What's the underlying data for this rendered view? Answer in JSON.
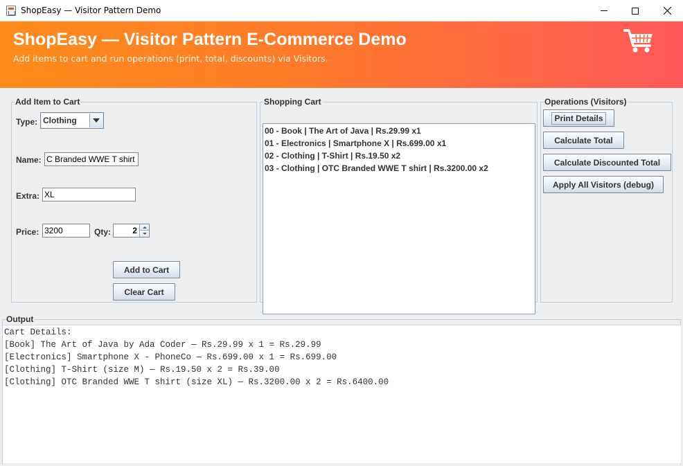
{
  "window": {
    "title": "ShopEasy — Visitor Pattern Demo"
  },
  "header": {
    "title": "ShopEasy — Visitor Pattern E-Commerce Demo",
    "subtitle": "Add items to cart and run operations (print, total, discounts) via Visitors.",
    "icon": "shopping-cart-icon"
  },
  "add_item": {
    "group_label": "Add Item to Cart",
    "type_label": "Type:",
    "type_value": "Clothing",
    "name_label": "Name:",
    "name_value": "C Branded WWE T shirt",
    "extra_label": "Extra:",
    "extra_value": "XL",
    "price_label": "Price:",
    "price_value": "3200",
    "qty_label": "Qty:",
    "qty_value": "2",
    "add_button": "Add to Cart",
    "clear_button": "Clear Cart"
  },
  "cart": {
    "group_label": "Shopping Cart",
    "items": [
      "00 - Book | The Art of Java | Rs.29.99 x1",
      "01 - Electronics | Smartphone X | Rs.699.00 x1",
      "02 - Clothing | T-Shirt | Rs.19.50 x2",
      "03 - Clothing | OTC Branded WWE T shirt | Rs.3200.00 x2"
    ]
  },
  "operations": {
    "group_label": "Operations (Visitors)",
    "print_button": "Print Details",
    "total_button": "Calculate Total",
    "discount_button": "Calculate Discounted Total",
    "apply_all_button": "Apply All Visitors (debug)"
  },
  "output": {
    "group_label": "Output",
    "lines": [
      "Cart Details:",
      "[Book] The Art of Java by Ada Coder — Rs.29.99 x 1 = Rs.29.99",
      "[Electronics] Smartphone X - PhoneCo — Rs.699.00 x 1 = Rs.699.00",
      "[Clothing] T-Shirt (size M) — Rs.19.50 x 2 = Rs.39.00",
      "[Clothing] OTC Branded WWE T shirt (size XL) — Rs.3200.00 x 2 = Rs.6400.00"
    ]
  },
  "colors": {
    "header_start": "#ff8c1a",
    "header_end": "#ff5858",
    "panel_bg": "#eeeeee",
    "group_border": "#b8cfe5"
  }
}
